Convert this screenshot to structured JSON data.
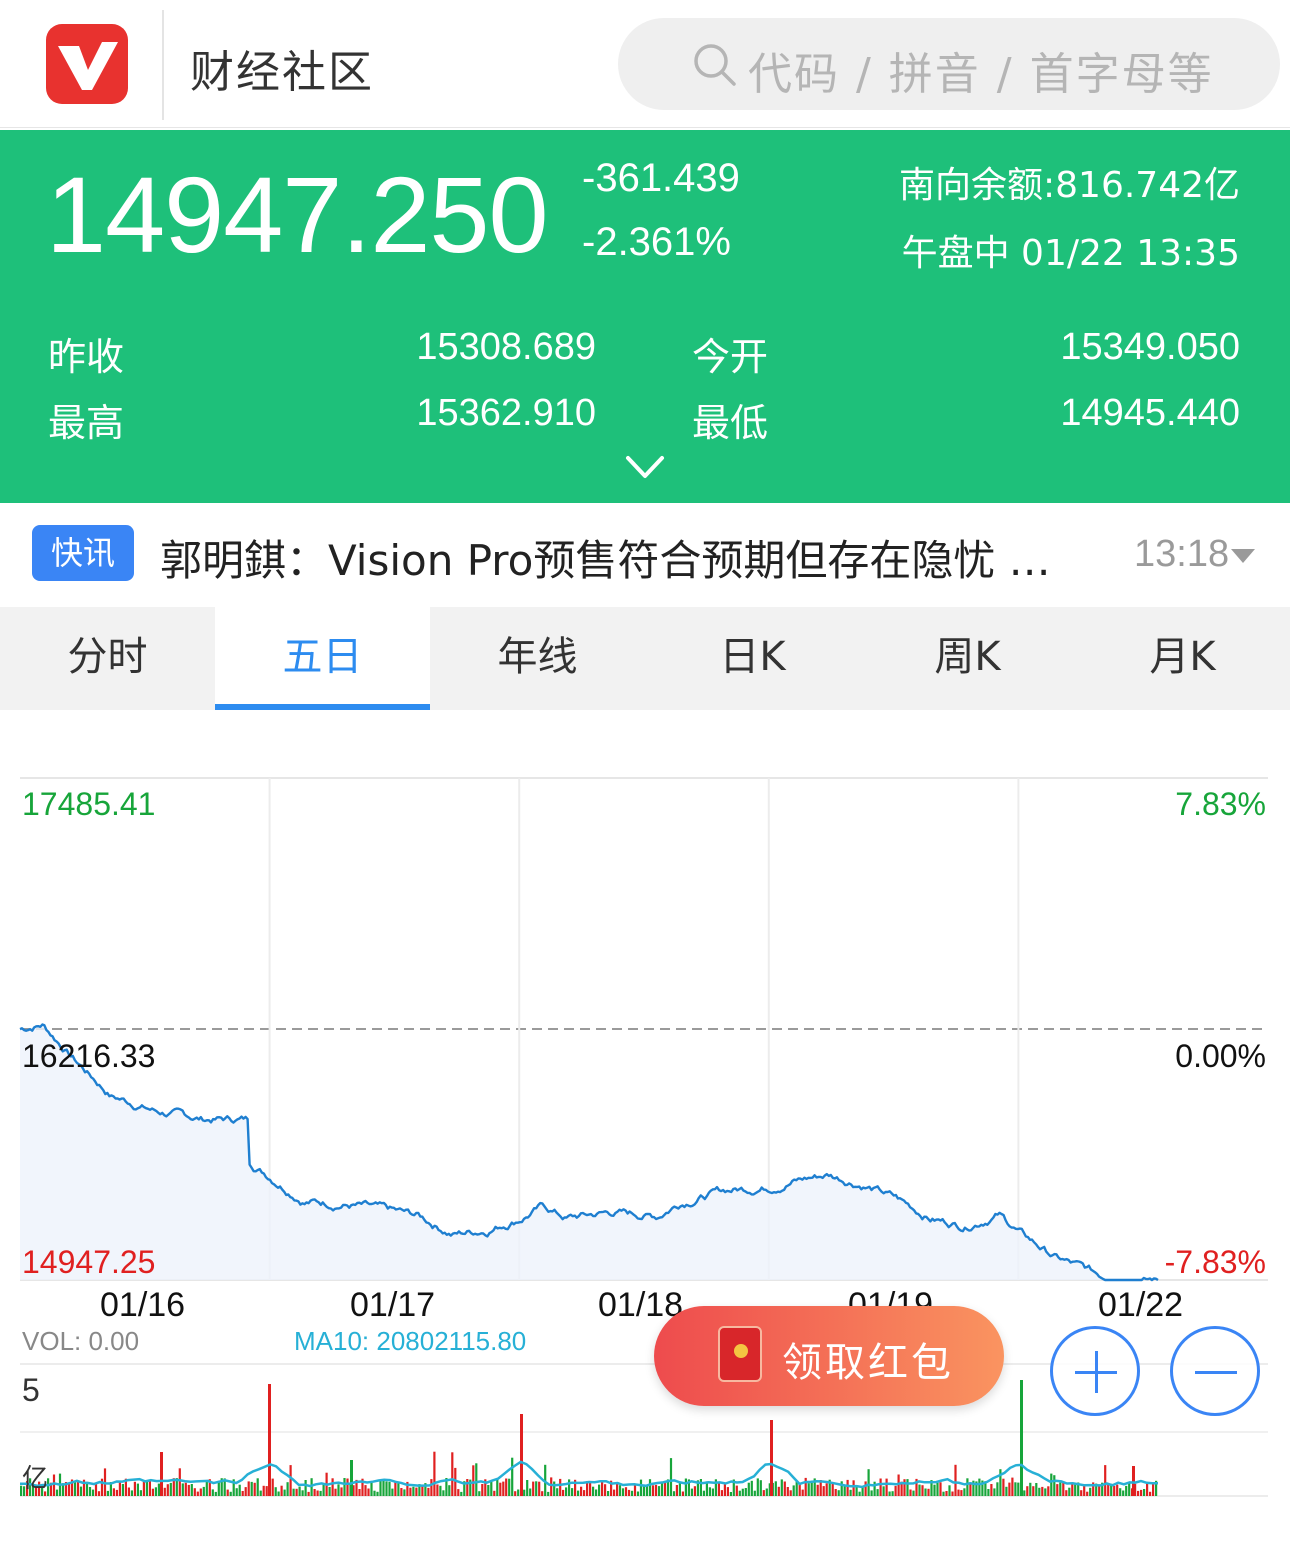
{
  "header": {
    "app_title": "财经社区",
    "search_placeholder": "代码 / 拼音 / 首字母等"
  },
  "quote": {
    "price": "14947.250",
    "change": "-361.439",
    "change_pct": "-2.361%",
    "southbound": "南向余额:816.742亿",
    "status_time": "午盘中 01/22 13:35",
    "prev_close_label": "昨收",
    "prev_close": "15308.689",
    "open_label": "今开",
    "open": "15349.050",
    "high_label": "最高",
    "high": "15362.910",
    "low_label": "最低",
    "low": "14945.440"
  },
  "news": {
    "badge": "快讯",
    "headline": "郭明錤：Vision Pro预售符合预期但存在隐忧 …",
    "time": "13:18"
  },
  "tabs": [
    {
      "label": "分时",
      "active": false
    },
    {
      "label": "五日",
      "active": true
    },
    {
      "label": "年线",
      "active": false
    },
    {
      "label": "日K",
      "active": false
    },
    {
      "label": "周K",
      "active": false
    },
    {
      "label": "月K",
      "active": false
    }
  ],
  "chart": {
    "top_price": "17485.41",
    "mid_price": "16216.33",
    "bottom_price": "14947.25",
    "top_pct": "7.83%",
    "mid_pct": "0.00%",
    "bottom_pct": "-7.83%",
    "dates": [
      "01/16",
      "01/17",
      "01/18",
      "01/19",
      "01/22"
    ],
    "vol_label": "VOL: 0.00",
    "ma10_label": "MA10: 20802115.80",
    "vol_scale_top": "5",
    "vol_scale_unit": "亿"
  },
  "chart_data": {
    "type": "line",
    "title": "",
    "xlabel": "",
    "ylabel": "",
    "ylim": [
      14947.25,
      17485.41
    ],
    "reference_close": 16216.33,
    "x": [
      "01/16",
      "01/17",
      "01/18",
      "01/19",
      "01/22"
    ],
    "series": [
      {
        "values": [
          16216.33,
          15850.0,
          15420.0,
          15540.0,
          14950.0
        ]
      }
    ]
  },
  "colors": {
    "quote_bg": "#1ec07a",
    "accent_blue": "#2d8cf0",
    "line_blue": "#1f7fd0",
    "up_red": "#e02020",
    "down_green": "#17a53a"
  },
  "overlays": {
    "redpacket_label": "领取红包",
    "zoom_in_icon": "plus-icon",
    "zoom_out_icon": "minus-icon"
  }
}
